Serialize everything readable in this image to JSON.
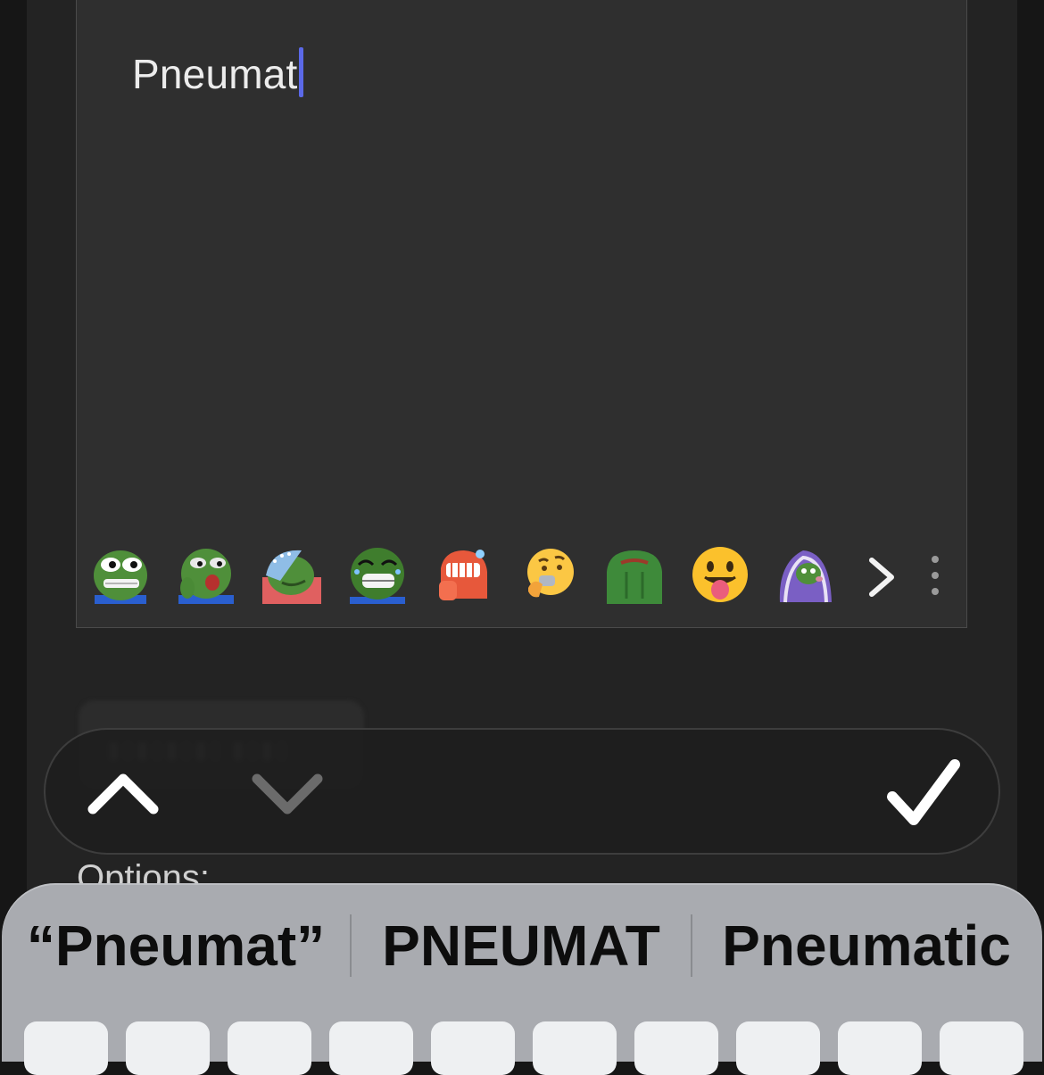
{
  "editor": {
    "text": "Pneumat"
  },
  "emoji_bar": {
    "items": [
      {
        "name": "pepe-grin-emoji"
      },
      {
        "name": "pepe-shocked-emoji"
      },
      {
        "name": "pepe-sleep-cap-emoji"
      },
      {
        "name": "pepe-laughing-crying-emoji"
      },
      {
        "name": "red-screaming-face-emoji"
      },
      {
        "name": "thinking-face-emoji"
      },
      {
        "name": "pepe-back-emoji"
      },
      {
        "name": "face-with-tongue-emoji"
      },
      {
        "name": "pepe-blanket-emoji"
      }
    ],
    "more_icon": "chevron-right-icon",
    "menu_icon": "more-vertical-icon"
  },
  "toolbar": {
    "up_icon": "chevron-up-icon",
    "down_icon": "chevron-down-icon",
    "done_icon": "checkmark-icon"
  },
  "options": {
    "label": "Options:"
  },
  "keyboard": {
    "suggestions": [
      "“Pneumat”",
      "PNEUMAT",
      "Pneumatic"
    ]
  },
  "colors": {
    "caret": "#5b69e8",
    "editor_bg": "#2f2f2f",
    "keyboard_bg": "#a9abb0"
  }
}
